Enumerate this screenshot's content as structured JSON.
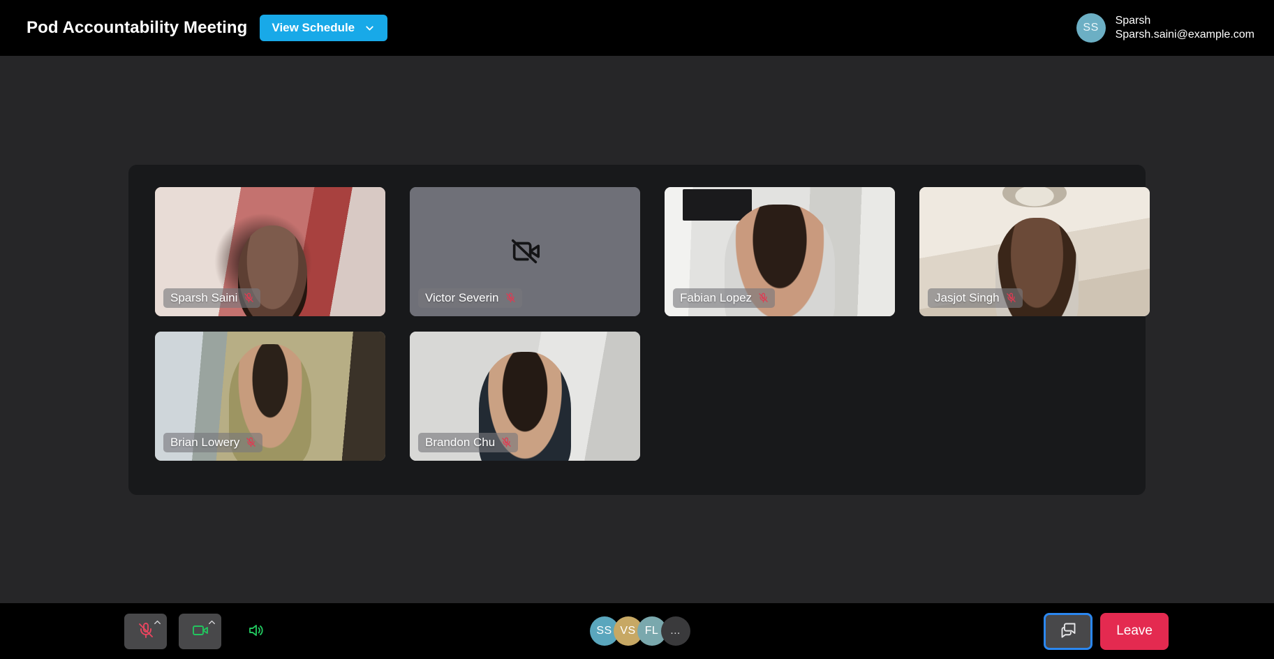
{
  "header": {
    "meeting_title": "Pod Accountability Meeting",
    "view_schedule_label": "View Schedule",
    "chevron_icon": "chevron-down-icon",
    "account": {
      "initials": "SS",
      "name": "Sparsh",
      "email": "Sparsh.saini@example.com",
      "avatar_color": "#6cafc4"
    }
  },
  "stage": {
    "participants": [
      {
        "name": "Sparsh Saini",
        "muted": true,
        "camera_on": true,
        "mic_icon": "mic-muted-icon"
      },
      {
        "name": "Victor Severin",
        "muted": true,
        "camera_on": false,
        "mic_icon": "mic-muted-icon",
        "camera_off_icon": "camera-off-icon"
      },
      {
        "name": "Fabian Lopez",
        "muted": true,
        "camera_on": true,
        "mic_icon": "mic-muted-icon"
      },
      {
        "name": "Jasjot Singh",
        "muted": true,
        "camera_on": true,
        "mic_icon": "mic-muted-icon"
      },
      {
        "name": "Brian Lowery",
        "muted": true,
        "camera_on": true,
        "mic_icon": "mic-muted-icon"
      },
      {
        "name": "Brandon Chu",
        "muted": true,
        "camera_on": true,
        "mic_icon": "mic-muted-icon"
      }
    ]
  },
  "toolbar": {
    "mic": {
      "icon": "mic-muted-icon",
      "state": "muted",
      "color": "#e8455f",
      "caret_icon": "chevron-up-icon"
    },
    "camera": {
      "icon": "camera-on-icon",
      "state": "on",
      "color": "#22c55e",
      "caret_icon": "chevron-up-icon"
    },
    "speaker": {
      "icon": "speaker-on-icon",
      "color": "#22c55e"
    },
    "participant_stack": [
      {
        "initials": "SS",
        "color": "#5aa6bd"
      },
      {
        "initials": "VS",
        "color": "#c7a864"
      },
      {
        "initials": "FL",
        "color": "#7aa8ad"
      },
      {
        "initials": "...",
        "color": "#3a3a3c"
      }
    ],
    "chat": {
      "icon": "chat-bubbles-icon",
      "focused": true,
      "focus_color": "#2b87f0"
    },
    "leave_label": "Leave",
    "leave_color": "#e42a50"
  }
}
